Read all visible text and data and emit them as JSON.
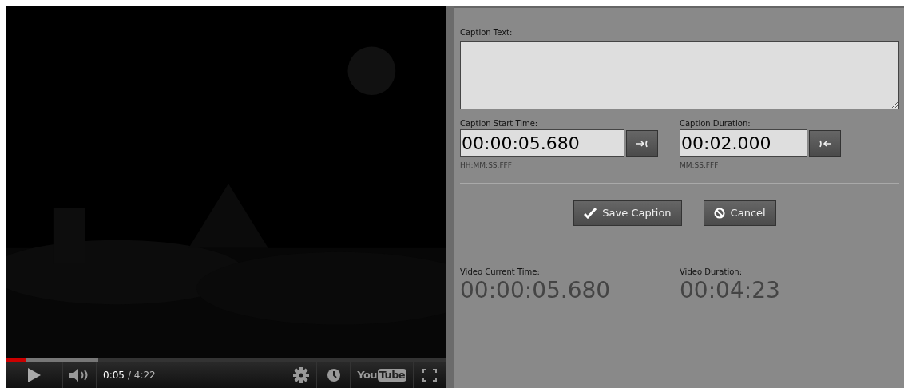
{
  "player": {
    "progress": {
      "level": 0.045,
      "buffered": {
        "level": 0.21
      }
    },
    "controls": {
      "playing": false,
      "time": "0:05",
      "duration": "/ 4:22",
      "logo": {
        "first": "You",
        "second": "Tube"
      }
    }
  },
  "editor": {
    "caption_text": {
      "label": "Caption Text:"
    },
    "start_time": {
      "label": "Caption Start Time:",
      "value": "00:00:05.680",
      "hint": "HH:MM:SS.FFF"
    },
    "duration": {
      "label": "Caption Duration:",
      "value": "00:02.000",
      "hint": "MM:SS.FFF"
    },
    "buttons": [
      {
        "kind": "save",
        "label": "Save Caption"
      },
      {
        "kind": "cancel",
        "label": "Cancel"
      }
    ],
    "video_current_time": {
      "label": "Video Current Time:",
      "value": "00:00:05.680"
    },
    "video_duration": {
      "label": "Video Duration:",
      "value": "00:04:23"
    }
  }
}
